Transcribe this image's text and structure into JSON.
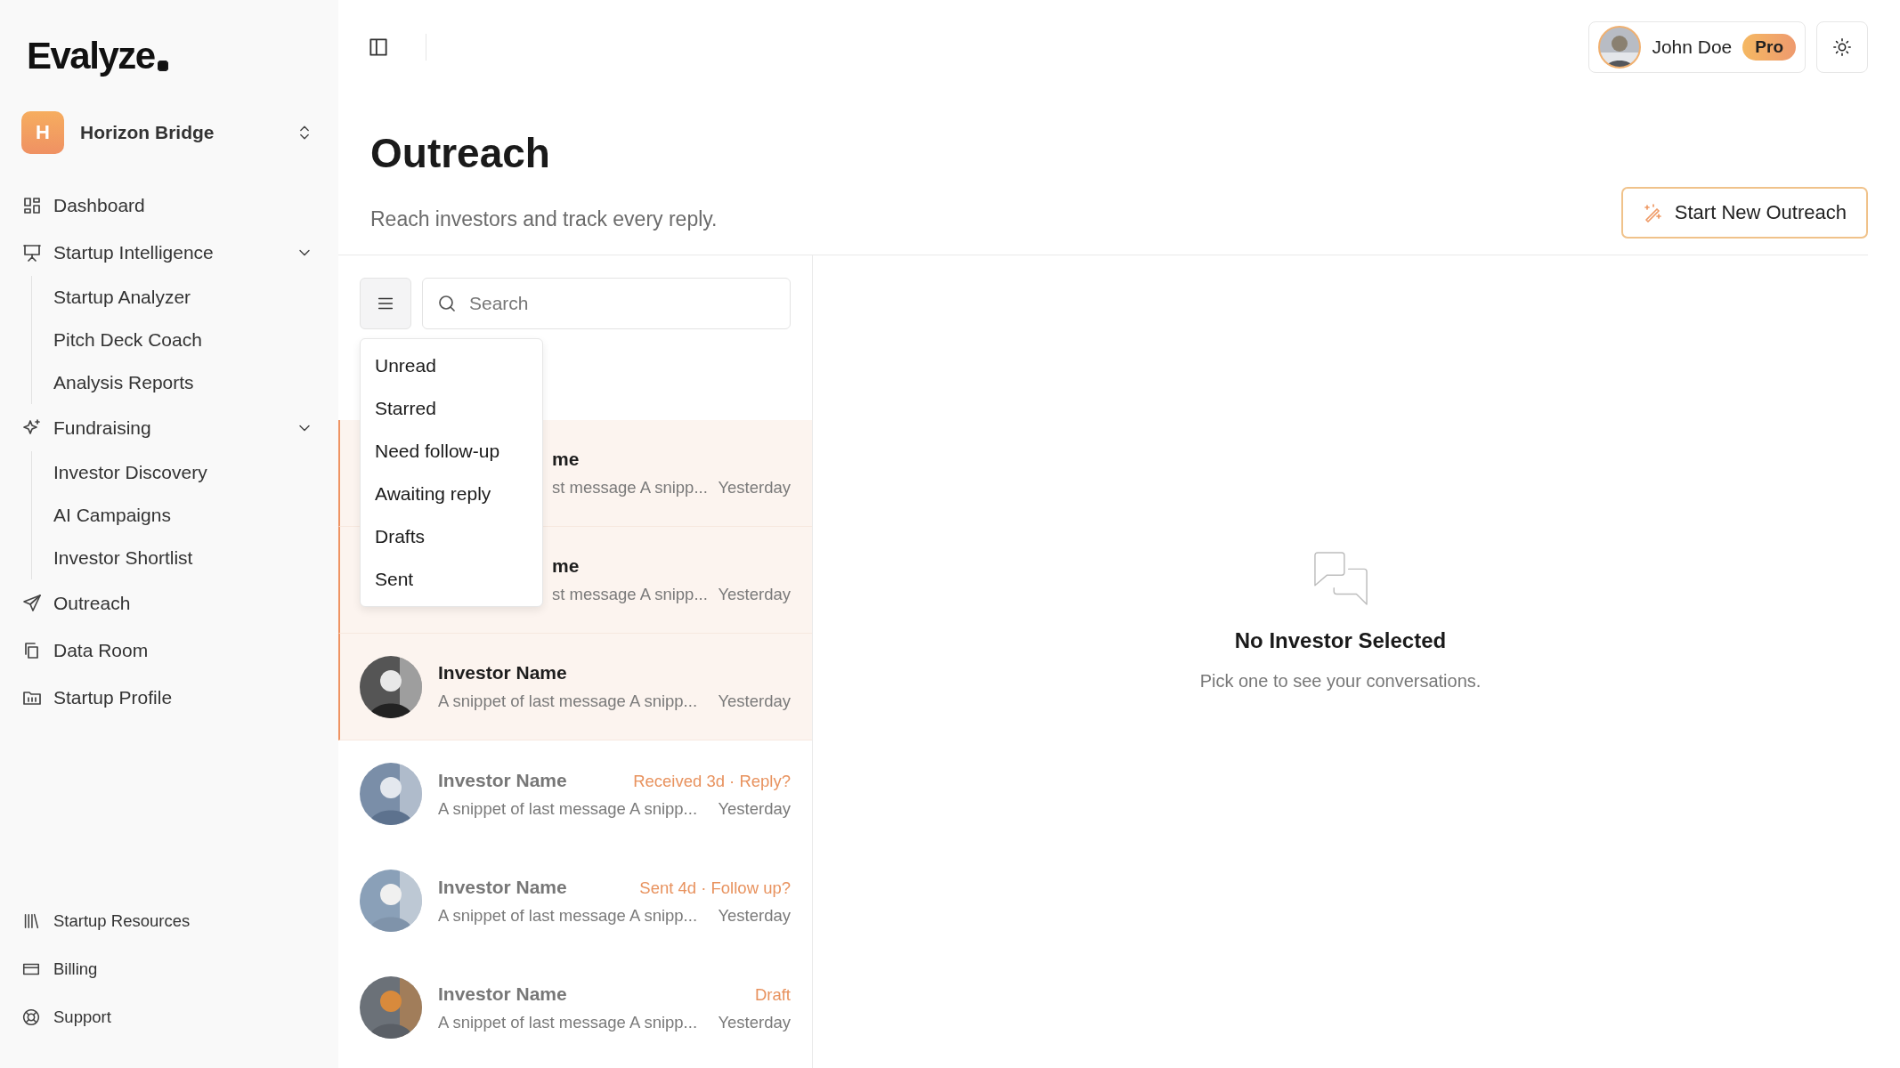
{
  "sidebar": {
    "logo": "Evalyze",
    "workspace": {
      "initial": "H",
      "name": "Horizon Bridge"
    },
    "nav": [
      {
        "label": "Dashboard"
      },
      {
        "label": "Startup Intelligence",
        "expanded": true,
        "children": [
          {
            "label": "Startup Analyzer"
          },
          {
            "label": "Pitch Deck Coach"
          },
          {
            "label": "Analysis Reports"
          }
        ]
      },
      {
        "label": "Fundraising",
        "expanded": true,
        "children": [
          {
            "label": "Investor Discovery"
          },
          {
            "label": "AI Campaigns"
          },
          {
            "label": "Investor Shortlist"
          }
        ]
      },
      {
        "label": "Outreach"
      },
      {
        "label": "Data Room"
      },
      {
        "label": "Startup Profile"
      }
    ],
    "footer": [
      {
        "label": "Startup Resources"
      },
      {
        "label": "Billing"
      },
      {
        "label": "Support"
      }
    ]
  },
  "user": {
    "name": "John Doe",
    "plan": "Pro"
  },
  "page": {
    "title": "Outreach",
    "subtitle": "Reach investors and track every reply.",
    "action": "Start New Outreach"
  },
  "search": {
    "placeholder": "Search"
  },
  "filter_menu": {
    "open": true,
    "items": [
      "Unread",
      "Starred",
      "Need follow-up",
      "Awaiting reply",
      "Drafts",
      "Sent"
    ]
  },
  "conversations": [
    {
      "covered": true,
      "unread": true,
      "name": "me",
      "snippet": "st message A snipp...",
      "time": "Yesterday"
    },
    {
      "covered": true,
      "unread": true,
      "name": "me",
      "snippet": "st message A snipp...",
      "time": "Yesterday"
    },
    {
      "covered": false,
      "unread": true,
      "name": "Investor Name",
      "snippet": "A snippet of last message A snipp...",
      "time": "Yesterday"
    },
    {
      "covered": false,
      "unread": false,
      "name": "Investor Name",
      "status": "Received 3d · Reply?",
      "snippet": "A snippet of last message A snipp...",
      "time": "Yesterday"
    },
    {
      "covered": false,
      "unread": false,
      "name": "Investor Name",
      "status": "Sent 4d · Follow up?",
      "snippet": "A snippet of last message A snipp...",
      "time": "Yesterday"
    },
    {
      "covered": false,
      "unread": false,
      "name": "Investor Name",
      "status": "Draft",
      "snippet": "A snippet of last message A snipp...",
      "time": "Yesterday"
    }
  ],
  "detail": {
    "title": "No Investor Selected",
    "subtitle": "Pick one to see your conversations."
  }
}
